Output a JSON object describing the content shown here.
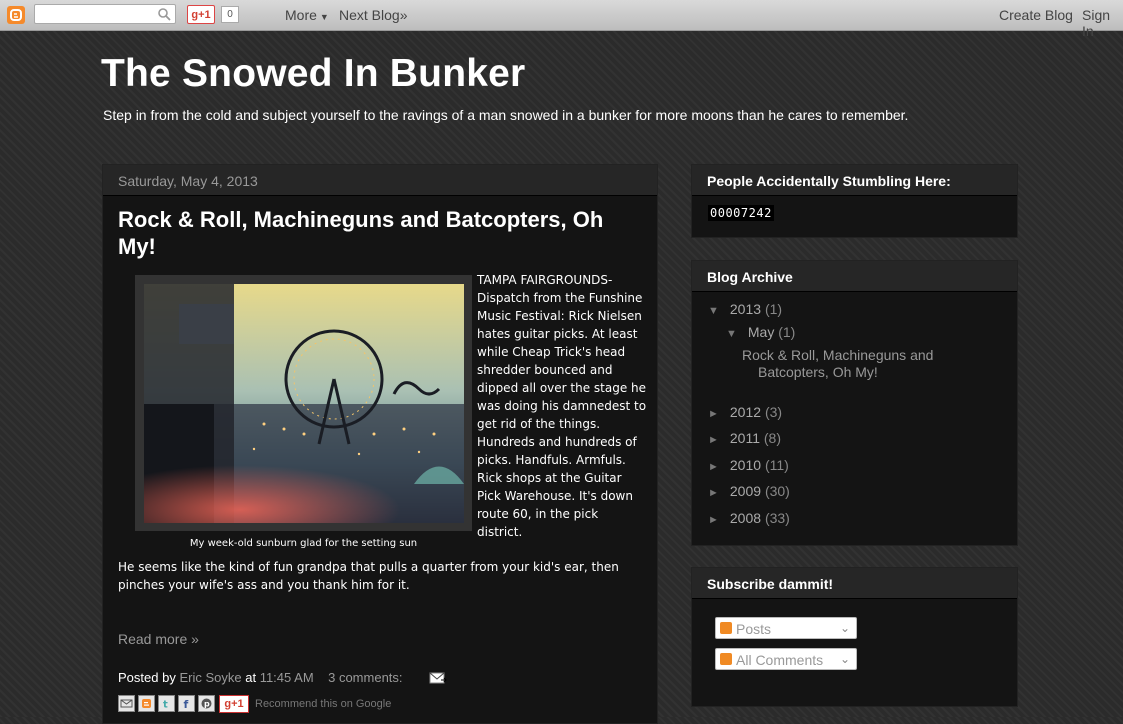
{
  "navbar": {
    "search_placeholder": "",
    "gplus_label": "g+1",
    "gplus_count": "0",
    "more": "More",
    "next_blog": "Next Blog»",
    "create_blog": "Create Blog",
    "sign_in": "Sign In"
  },
  "header": {
    "title": "The Snowed In Bunker",
    "description": "Step in from the cold and subject yourself to the ravings of a man snowed in a bunker for more moons than he cares to remember."
  },
  "post": {
    "date": "Saturday, May 4, 2013",
    "title": "Rock & Roll, Machineguns and Batcopters, Oh My!",
    "caption": "My week-old sunburn glad for the setting sun",
    "body_right": "TAMPA FAIRGROUNDS- Dispatch from the Funshine Music Festival: Rick Nielsen hates guitar picks. At least while Cheap Trick's head shredder bounced and dipped all over the stage he was doing his damnedest to get rid of the things. Hundreds and hundreds of picks. Handfuls. Armfuls. Rick shops at the Guitar Pick Warehouse. It's down route 60, in the pick district.",
    "body_cont": "He seems like the kind of fun grandpa that pulls a quarter from your kid's ear, then pinches your wife's ass and you thank him for it.",
    "read_more": "Read more »",
    "posted_by_label": "Posted by",
    "author": "Eric Soyke",
    "at_label": "at",
    "time": "11:45 AM",
    "comments": "3 comments:",
    "recommend": "Recommend this on Google",
    "share_gplus": "g+1"
  },
  "sidebar": {
    "visitors": {
      "title": "People Accidentally Stumbling Here:",
      "count": "00007242"
    },
    "archive": {
      "title": "Blog Archive",
      "years": [
        {
          "year": "2013",
          "count": "(1)",
          "toggle": "▼"
        },
        {
          "year": "2012",
          "count": "(3)",
          "toggle": "►"
        },
        {
          "year": "2011",
          "count": "(8)",
          "toggle": "►"
        },
        {
          "year": "2010",
          "count": "(11)",
          "toggle": "►"
        },
        {
          "year": "2009",
          "count": "(30)",
          "toggle": "►"
        },
        {
          "year": "2008",
          "count": "(33)",
          "toggle": "►"
        }
      ],
      "month": {
        "name": "May",
        "count": "(1)",
        "toggle": "▼"
      },
      "post_title_line1": "Rock & Roll, Machineguns and",
      "post_title_line2": "Batcopters, Oh My!"
    },
    "subscribe": {
      "title": "Subscribe dammit!",
      "posts_label": "Posts",
      "comments_label": "All Comments"
    }
  },
  "colors": {
    "accent": "#f58a2b",
    "background": "#2b2b2b",
    "panel": "#141414"
  }
}
